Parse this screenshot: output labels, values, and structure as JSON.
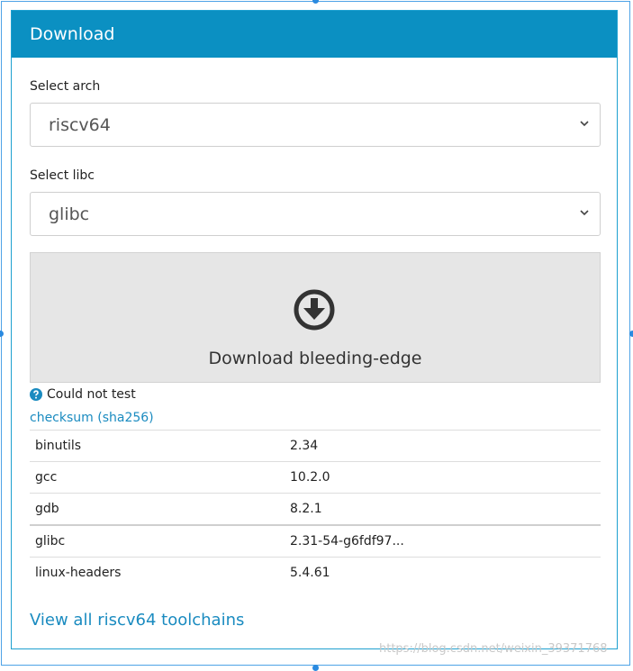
{
  "panel": {
    "title": "Download"
  },
  "arch": {
    "label": "Select arch",
    "selected": "riscv64"
  },
  "libc": {
    "label": "Select libc",
    "selected": "glibc"
  },
  "download": {
    "label": "Download bleeding-edge",
    "icon": "download-circle-icon"
  },
  "status": {
    "icon": "question-circle-icon",
    "text": "Could not test",
    "color": "#1a8bc0"
  },
  "checksum": {
    "label": "checksum (sha256)"
  },
  "packages": [
    {
      "name": "binutils",
      "version": "2.34"
    },
    {
      "name": "gcc",
      "version": "10.2.0"
    },
    {
      "name": "gdb",
      "version": "8.2.1"
    },
    {
      "name": "glibc",
      "version": "2.31-54-g6fdf97..."
    },
    {
      "name": "linux-headers",
      "version": "5.4.61"
    }
  ],
  "view_all": {
    "label": "View all riscv64 toolchains"
  },
  "watermark": {
    "text": "https://blog.csdn.net/weixin_39371768"
  },
  "colors": {
    "header": "#0b90c2",
    "link": "#1a8bc0",
    "button_bg": "#e6e6e6"
  }
}
